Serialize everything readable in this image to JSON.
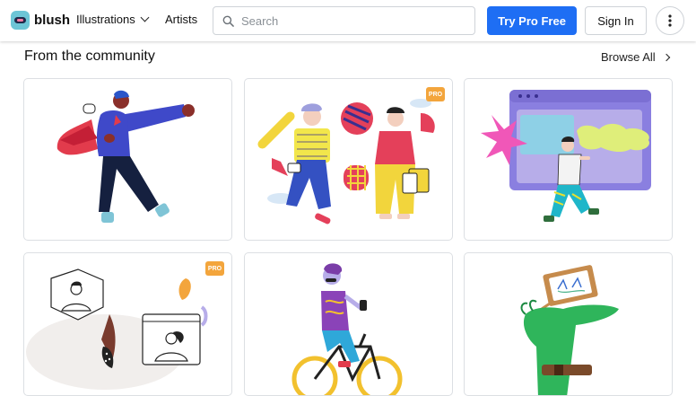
{
  "header": {
    "logo_text": "blush",
    "nav_illustrations": "Illustrations",
    "nav_artists": "Artists",
    "search_placeholder": "Search",
    "try_pro_label": "Try Pro Free",
    "sign_in_label": "Sign In"
  },
  "section": {
    "title": "From the community",
    "browse_all_label": "Browse All"
  },
  "cards": [
    {
      "pro": false
    },
    {
      "pro": true,
      "badge": "PRO"
    },
    {
      "pro": false
    },
    {
      "pro": true,
      "badge": "PRO"
    },
    {
      "pro": false
    },
    {
      "pro": false
    }
  ],
  "colors": {
    "accent": "#1e6ef4",
    "pro_badge": "#f3a53c"
  }
}
